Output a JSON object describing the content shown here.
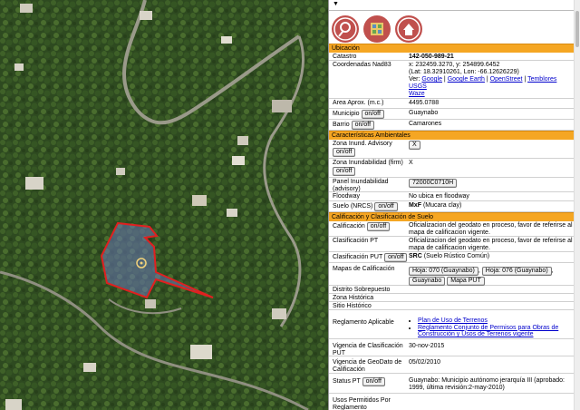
{
  "icons": [
    {
      "name": "tool-icon",
      "color": "#c0504d"
    },
    {
      "name": "crim-logo-icon",
      "color": "#c0504d"
    },
    {
      "name": "house-pin-icon",
      "color": "#c0504d"
    }
  ],
  "sections": {
    "ubicacion": "Ubicación",
    "ambientales": "Características Ambientales",
    "calificacion": "Calificación y Clasificación de Suelo"
  },
  "catastro": {
    "label": "Catastro",
    "value": "142-050-989-21"
  },
  "coords": {
    "label": "Coordenadas Nad83",
    "xy": "x: 232459.3270, y: 254899.6452",
    "latlon": "(Lat: 18.32910261, Lon: -66.12626229)",
    "ver": "Ver:",
    "links": [
      "Google",
      "Google Earth",
      "OpenStreet",
      "Temblores USGS",
      "Waze"
    ]
  },
  "area": {
    "label": "Area Aprox. (m.c.)",
    "value": "4495.0788"
  },
  "onoff": "on/off",
  "municipio": {
    "label": "Municipio",
    "value": "Guaynabo"
  },
  "barrio": {
    "label": "Barrio",
    "value": "Camarones"
  },
  "zona_inund": {
    "label": "Zona Inund. Advisory",
    "value": "X"
  },
  "zona_inund_firm": {
    "label": "Zona Inundabilidad (firm)",
    "value": "X"
  },
  "panel_inund": {
    "label": "Panel Inundabilidad (advisory)",
    "value": "72000C0710H"
  },
  "floodway": {
    "label": "Floodway",
    "value": "No ubica en floodway"
  },
  "suelo": {
    "label": "Suelo (NRCS)",
    "code": "MxF",
    "desc": "(Mucara clay)"
  },
  "calificacion": {
    "label": "Calificación",
    "value": "Oficializacion del geodato en proceso, favor de referirse al mapa de calificacion vigente."
  },
  "clasif_pt": {
    "label": "Clasificación PT",
    "value": "Oficializacion del geodato en proceso, favor de referirse al mapa de calificacion vigente."
  },
  "clasif_put": {
    "label": "Clasificación PUT",
    "code": "SRC",
    "desc": "(Suelo Rústico Común)"
  },
  "mapas": {
    "label": "Mapas de Calificación",
    "buttons": [
      "Hoja: 070 (Guaynabo)",
      "Hoja: 076 (Guaynabo)",
      "Guaynabo",
      "Mapa PUT"
    ]
  },
  "distrito": {
    "label": "Distrito Sobrepuesto"
  },
  "zona_hist": {
    "label": "Zona Histórica"
  },
  "sitio_hist": {
    "label": "Sitio Histórico"
  },
  "reglamento": {
    "label": "Reglamento Aplicable",
    "links": [
      "Plan de Uso de Terrenos",
      "Reglamento Conjunto de Permisos para Obras de Construcción y Usos de Terrenos vigente"
    ]
  },
  "vigencia_put": {
    "label": "Vigencia de Clasificación PUT",
    "value": "30-nov-2015"
  },
  "vigencia_geo": {
    "label": "Vigencia de GeoDato de Calificación",
    "value": "05/02/2010"
  },
  "status_pt": {
    "label": "Status PT",
    "value": "Guaynabo: Municipio autónomo jerarquía III (aprobado: 1999, última revisión:2-may-2010)"
  },
  "usos": {
    "label": "Usos Permitidos Por Reglamento"
  }
}
